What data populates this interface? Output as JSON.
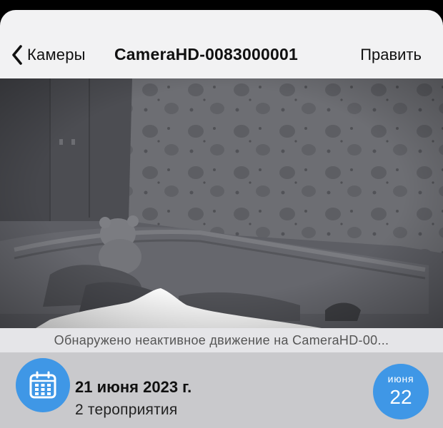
{
  "nav": {
    "back_label": "Камеры",
    "title": "CameraHD-0083000001",
    "edit_label": "Править",
    "back_icon": "chevron-left-icon"
  },
  "camera": {
    "feed_description_icon": "camera-feed",
    "caption": "Обнаружено неактивное движение на CameraHD-00..."
  },
  "event": {
    "calendar_icon": "calendar-icon",
    "date": "21 июня 2023 г.",
    "count": "2 тероприятия",
    "day_month": "июня",
    "day_number": "22"
  },
  "colors": {
    "accent": "#3f97e6",
    "nav_bg": "#f2f2f3",
    "caption_bg": "#e5e5e8",
    "event_bar_bg": "#c9c9cc"
  }
}
